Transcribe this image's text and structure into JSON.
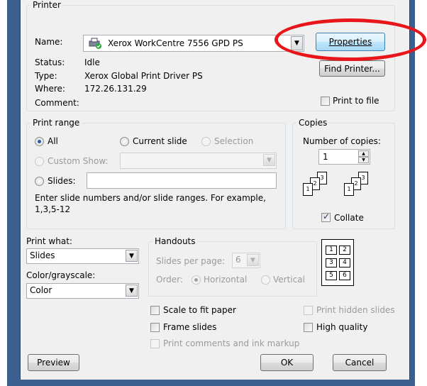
{
  "printer": {
    "group_label": "Printer",
    "name_label": "Name:",
    "name_value": "Xerox WorkCentre 7556 GPD PS",
    "properties_label": "Properties",
    "find_printer_label": "Find Printer...",
    "status_label": "Status:",
    "status_value": "Idle",
    "type_label": "Type:",
    "type_value": "Xerox Global Print Driver PS",
    "where_label": "Where:",
    "where_value": "172.26.131.29",
    "comment_label": "Comment:",
    "print_to_file_label": "Print to file"
  },
  "print_range": {
    "group_label": "Print range",
    "all_label": "All",
    "current_slide_label": "Current slide",
    "selection_label": "Selection",
    "custom_show_label": "Custom Show:",
    "slides_label": "Slides:",
    "hint": "Enter slide numbers and/or slide ranges. For example,",
    "hint2": "1,3,5-12"
  },
  "copies": {
    "group_label": "Copies",
    "number_label": "Number of copies:",
    "number_value": "1",
    "collate_label": "Collate"
  },
  "print_what": {
    "label": "Print what:",
    "value": "Slides",
    "color_label": "Color/grayscale:",
    "color_value": "Color"
  },
  "handouts": {
    "group_label": "Handouts",
    "per_page_label": "Slides per page:",
    "per_page_value": "6",
    "order_label": "Order:",
    "horizontal_label": "Horizontal",
    "vertical_label": "Vertical",
    "preview_numbers": [
      "1",
      "2",
      "3",
      "4",
      "5",
      "6"
    ]
  },
  "options": {
    "scale_to_fit": "Scale to fit paper",
    "frame_slides": "Frame slides",
    "print_comments": "Print comments and ink markup",
    "print_hidden": "Print hidden slides",
    "high_quality": "High quality"
  },
  "buttons": {
    "preview": "Preview",
    "ok": "OK",
    "cancel": "Cancel"
  }
}
